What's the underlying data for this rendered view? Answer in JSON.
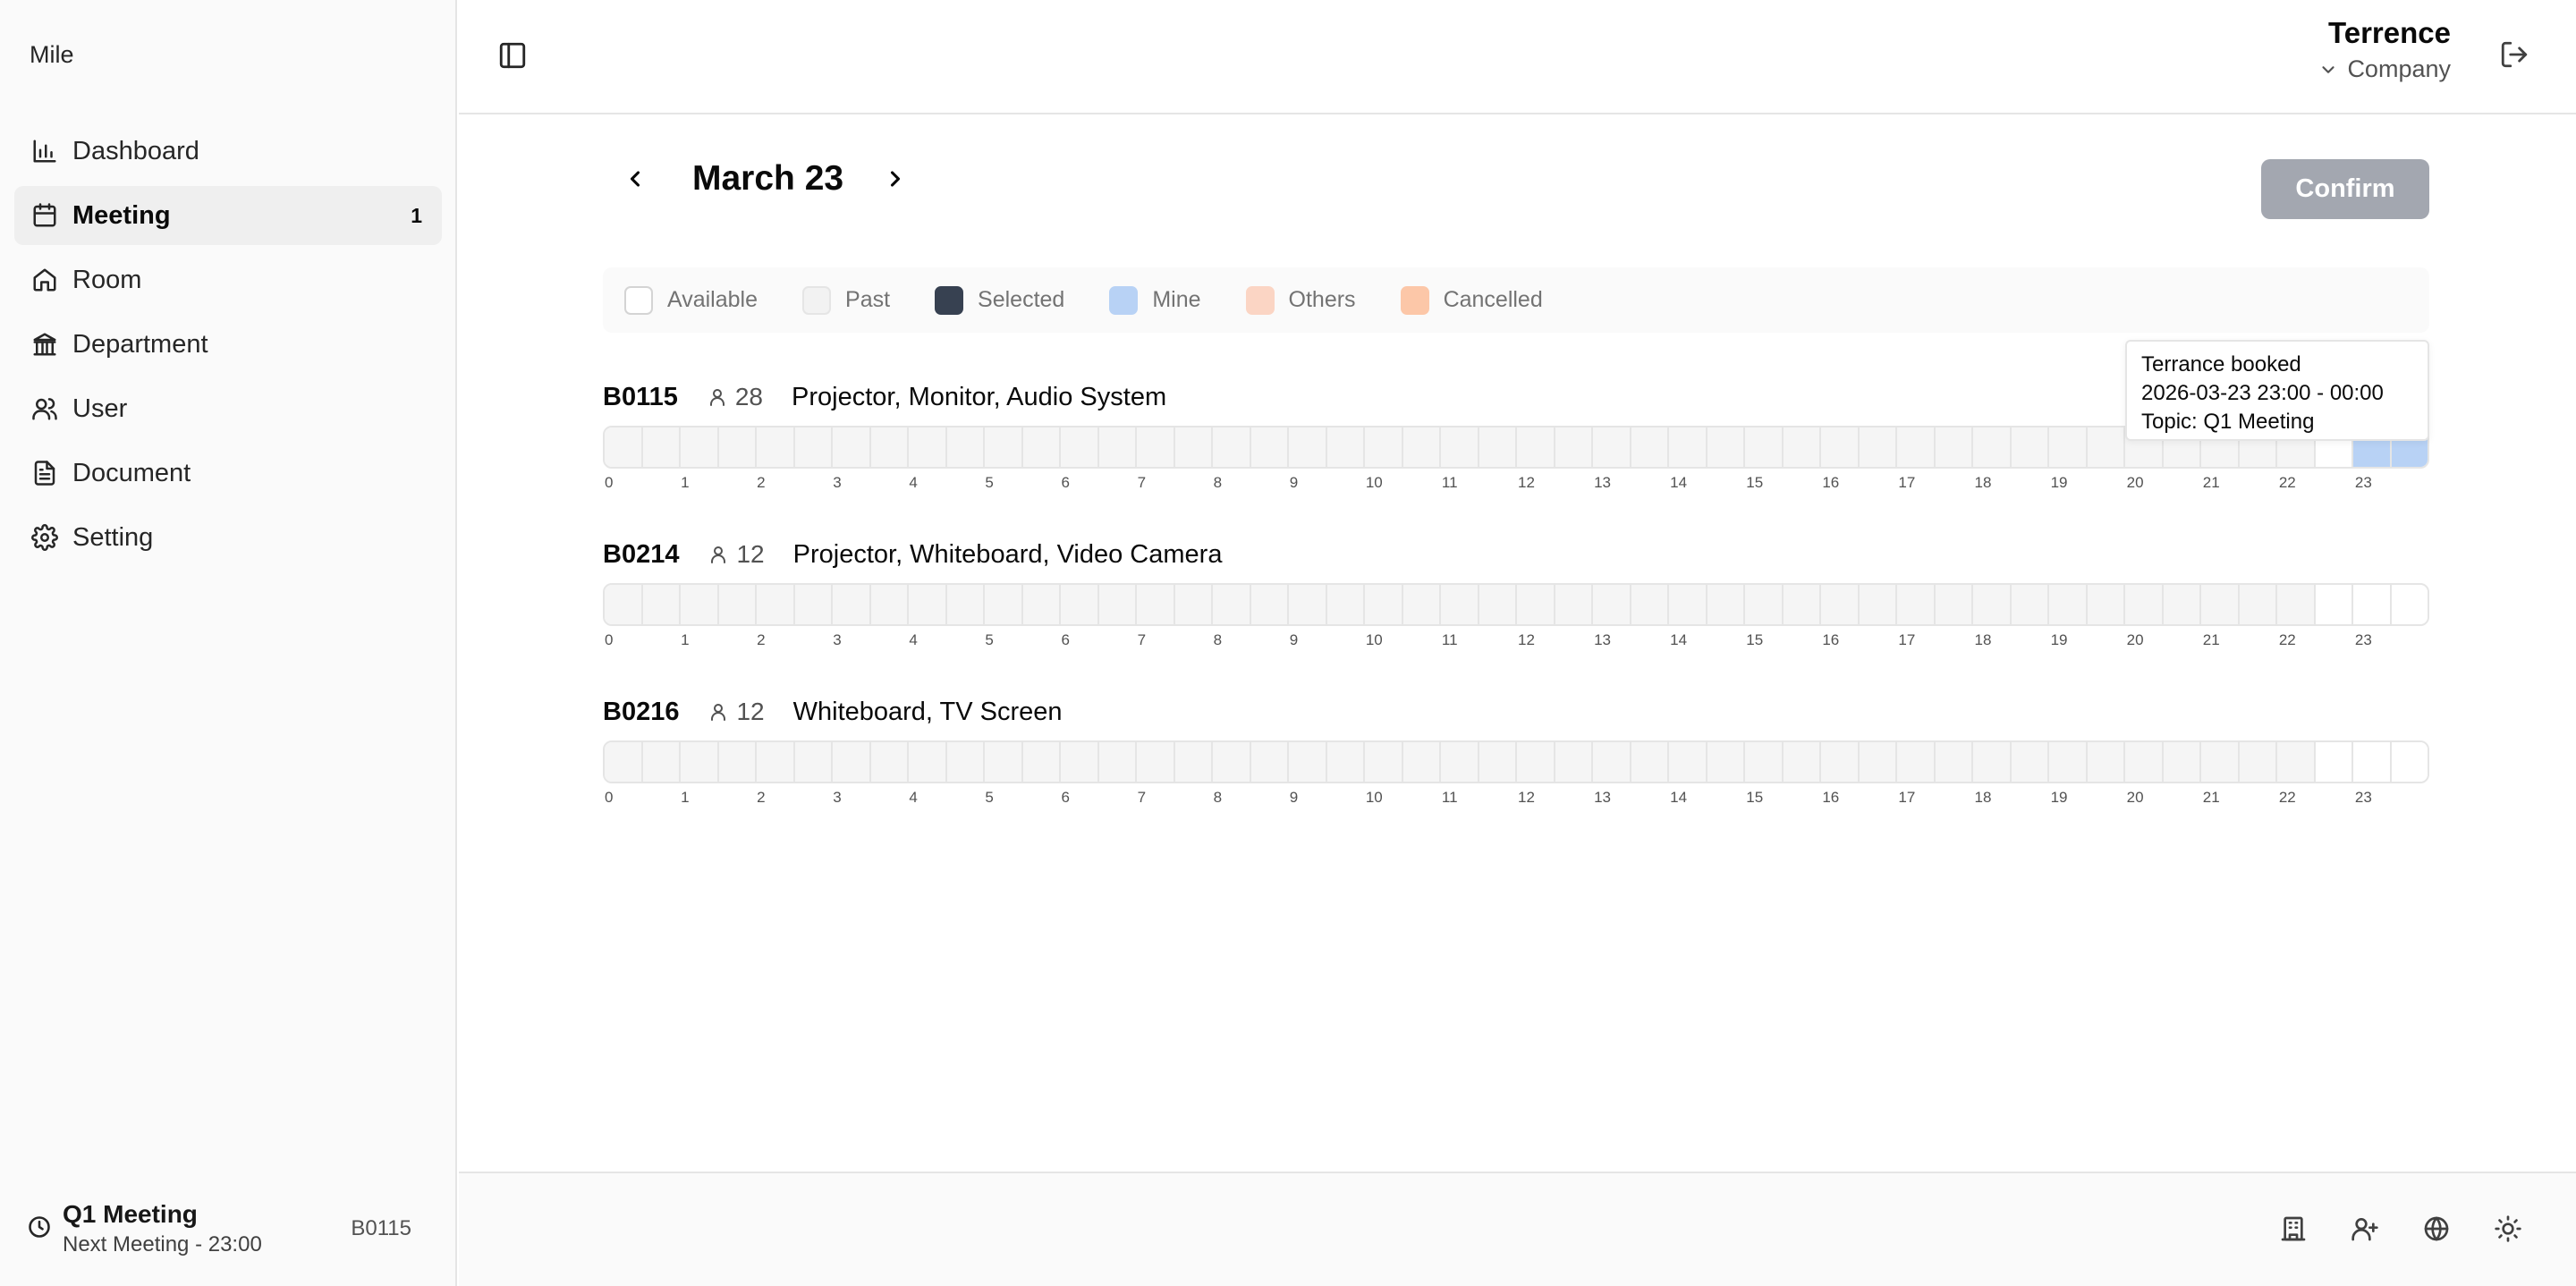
{
  "app": {
    "brand": "Mile"
  },
  "sidebar": {
    "items": [
      {
        "label": "Dashboard",
        "icon": "bar-chart-icon",
        "badge": ""
      },
      {
        "label": "Meeting",
        "icon": "calendar-icon",
        "badge": "1",
        "active": true
      },
      {
        "label": "Room",
        "icon": "home-icon",
        "badge": ""
      },
      {
        "label": "Department",
        "icon": "building-columns-icon",
        "badge": ""
      },
      {
        "label": "User",
        "icon": "users-icon",
        "badge": ""
      },
      {
        "label": "Document",
        "icon": "document-icon",
        "badge": ""
      },
      {
        "label": "Setting",
        "icon": "gear-icon",
        "badge": ""
      }
    ],
    "next_meeting": {
      "title": "Q1 Meeting",
      "subtitle": "Next Meeting - 23:00",
      "room": "B0115"
    }
  },
  "header": {
    "user_name": "Terrence",
    "company": "Company"
  },
  "main": {
    "date": "March 23",
    "confirm_label": "Confirm",
    "legend": [
      {
        "label": "Available",
        "color": "#ffffff",
        "border": "#d4d4d4"
      },
      {
        "label": "Past",
        "color": "#f2f2f2",
        "border": "#e5e5e5"
      },
      {
        "label": "Selected",
        "color": "#374151",
        "border": "#374151"
      },
      {
        "label": "Mine",
        "color": "#b8d2f5",
        "border": "#b8d2f5"
      },
      {
        "label": "Others",
        "color": "#fbd5c4",
        "border": "#fbd5c4"
      },
      {
        "label": "Cancelled",
        "color": "#fcc7a8",
        "border": "#fcc7a8"
      }
    ],
    "hours": [
      "0",
      "1",
      "2",
      "3",
      "4",
      "5",
      "6",
      "7",
      "8",
      "9",
      "10",
      "11",
      "12",
      "13",
      "14",
      "15",
      "16",
      "17",
      "18",
      "19",
      "20",
      "21",
      "22",
      "23"
    ],
    "rooms": [
      {
        "id": "B0115",
        "capacity": "28",
        "equipment": "Projector, Monitor, Audio System",
        "slot_states": {
          "available_from": 45,
          "mine": [
            46,
            47
          ]
        }
      },
      {
        "id": "B0214",
        "capacity": "12",
        "equipment": "Projector, Whiteboard, Video Camera",
        "slot_states": {
          "available_from": 45,
          "mine": []
        }
      },
      {
        "id": "B0216",
        "capacity": "12",
        "equipment": "Whiteboard, TV Screen",
        "slot_states": {
          "available_from": 45,
          "mine": []
        }
      }
    ],
    "tooltip": {
      "line1": "Terrance booked",
      "line2": "2026-03-23 23:00 - 00:00",
      "line3": "Topic: Q1 Meeting"
    }
  },
  "footer": {
    "icons": [
      "building-icon",
      "user-plus-icon",
      "globe-icon",
      "sun-icon"
    ]
  }
}
